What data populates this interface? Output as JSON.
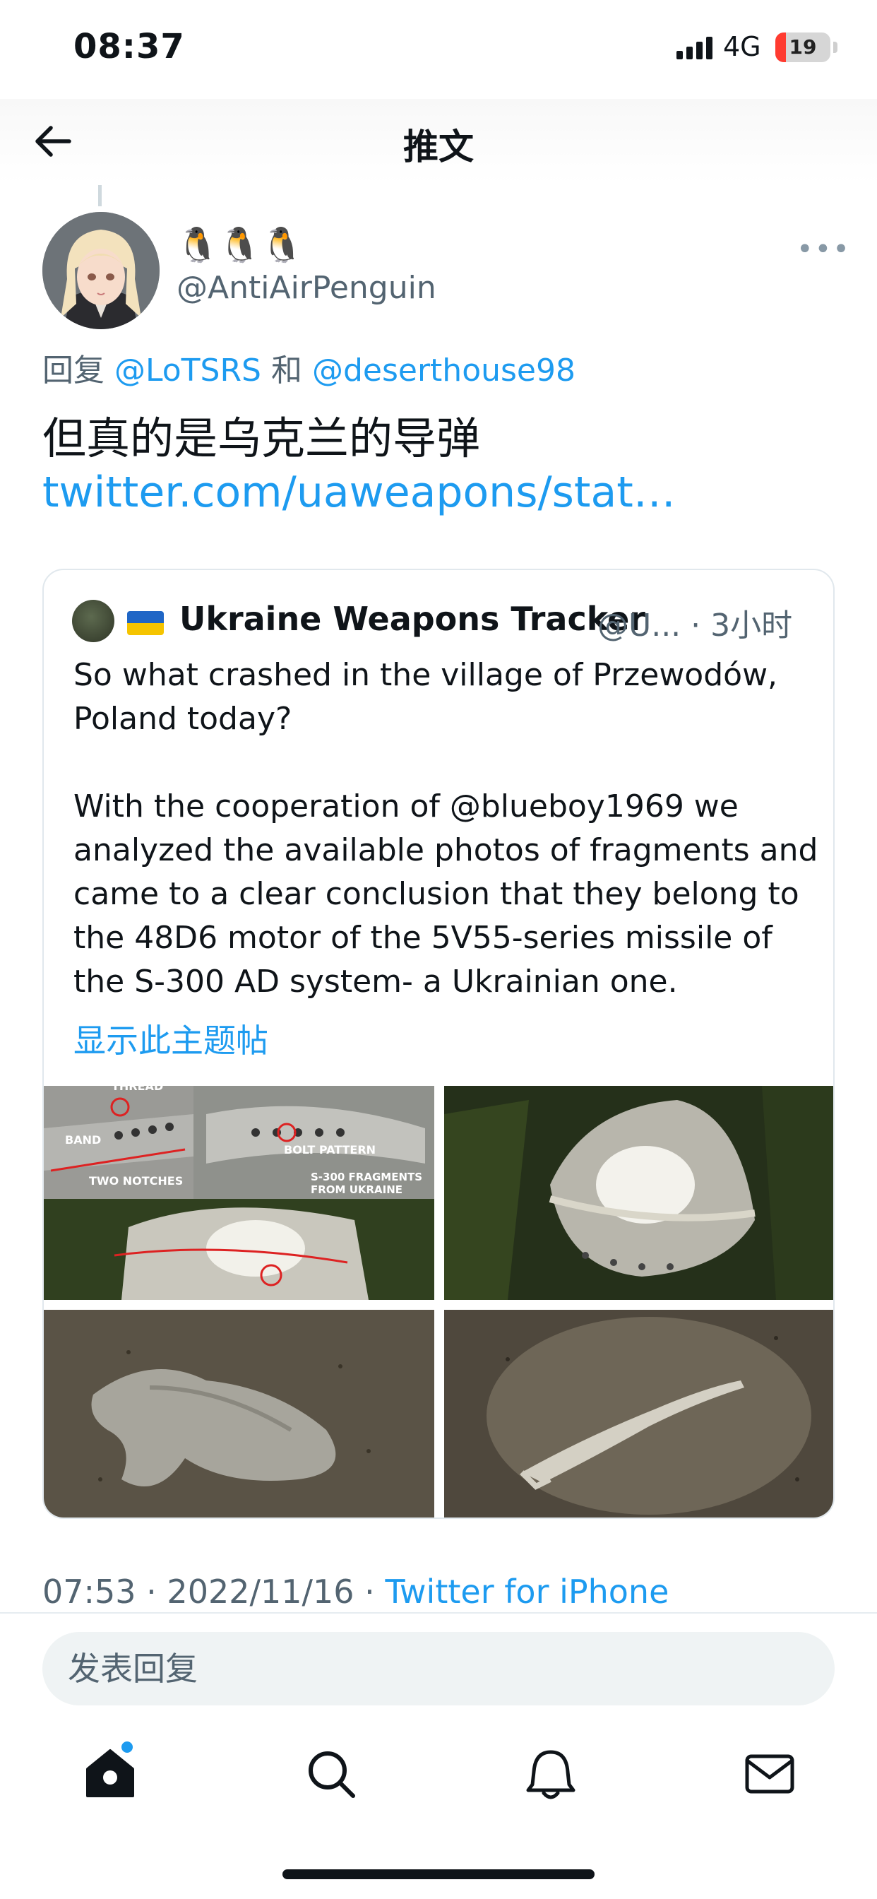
{
  "status_bar": {
    "time": "08:37",
    "network": "4G",
    "battery": "19",
    "battery_level_percent": 19
  },
  "header": {
    "title": "推文",
    "back_icon": "arrow-left-icon"
  },
  "tweet": {
    "display_name": "🐧🐧🐧",
    "handle": "@AntiAirPenguin",
    "reply_prefix": "回复",
    "mention_1": "@LoTSRS",
    "reply_joiner": "和",
    "mention_2": "@deserthouse98",
    "text": "但真的是乌克兰的导弹",
    "link": "twitter.com/uaweapons/stat…",
    "timestamp": "07:53 · 2022/11/16 · ",
    "source": "Twitter for iPhone"
  },
  "quote": {
    "name": "Ukraine Weapons Tracker",
    "handle_time": "@U... · 3小时",
    "line1": "So what crashed in the village of Przewodów,",
    "line2": "Poland today?",
    "line3": "",
    "line4": "With the cooperation of @blueboy1969 we",
    "line5": "analyzed the available photos of fragments and",
    "line6": "came to a clear conclusion that they belong to",
    "line7": "the 48D6 motor of the 5V55-series missile of",
    "line8": "the S-300 AD system- a Ukrainian one.",
    "show_thread": "显示此主题帖",
    "image_labels": {
      "thread": "THREAD",
      "band": "BAND",
      "two_notches": "TWO NOTCHES",
      "bolt_pattern": "BOLT PATTERN",
      "fragments_line1": "S-300 FRAGMENTS",
      "fragments_line2": "FROM UKRAINE"
    }
  },
  "reply_box": {
    "placeholder": "发表回复"
  },
  "tabs": [
    "home-icon",
    "search-icon",
    "notifications-icon",
    "messages-icon"
  ]
}
